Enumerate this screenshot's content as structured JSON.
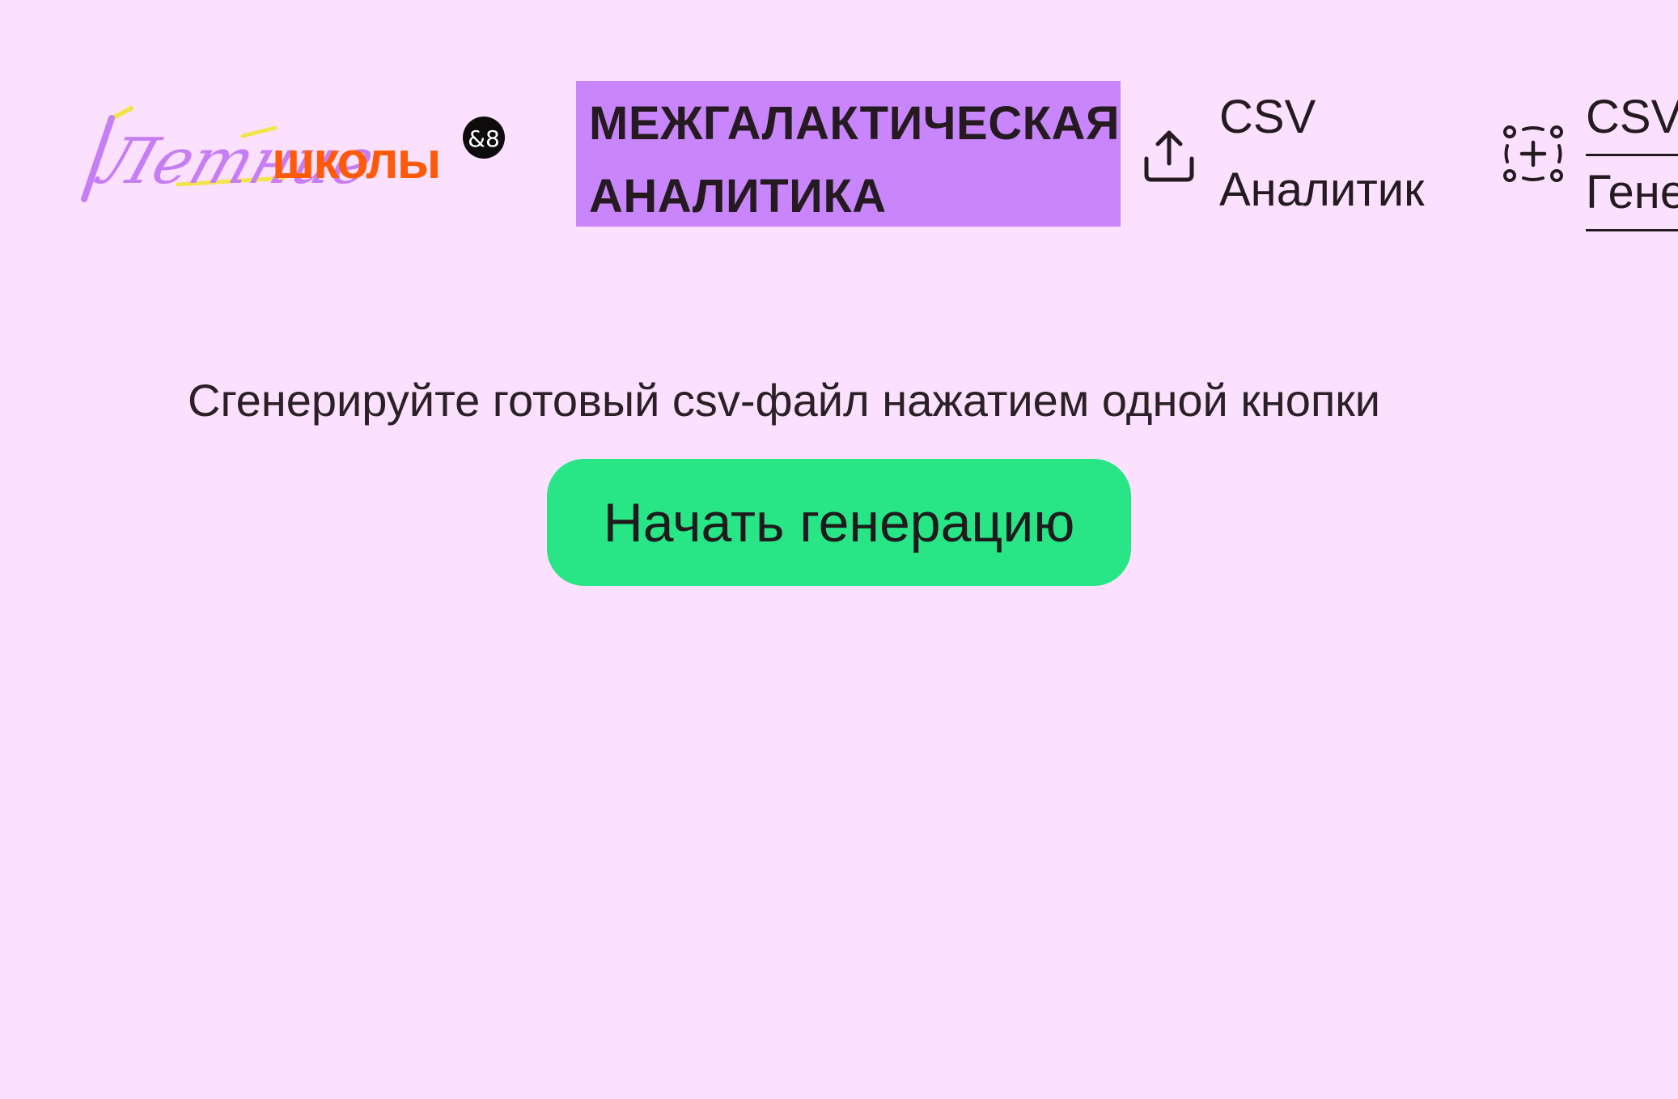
{
  "header": {
    "logo": {
      "text_script": "Летние",
      "text_bold": "школы",
      "badge": "&8"
    },
    "brand": {
      "line1": "МЕЖГАЛАКТИЧЕСКАЯ",
      "line2": "АНАЛИТИКА"
    },
    "nav": [
      {
        "line1": "CSV",
        "line2": "Аналитик",
        "icon": "upload-icon"
      },
      {
        "line1": "CSV",
        "line2": "Генератор",
        "icon": "add-frame-icon"
      }
    ]
  },
  "main": {
    "subtitle": "Сгенерируйте готовый csv-файл нажатием одной кнопки",
    "start_button": "Начать генерацию"
  },
  "colors": {
    "background": "#fbe1fe",
    "brand_box": "#c985fb",
    "button": "#28e586",
    "logo_orange": "#ff5a0a",
    "logo_purple": "#c67ef5",
    "logo_yellow": "#f5e84a"
  }
}
